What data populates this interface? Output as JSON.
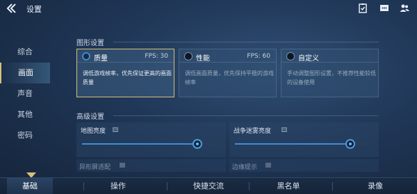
{
  "header": {
    "title": "设置"
  },
  "sidebar": {
    "items": [
      {
        "label": "综合"
      },
      {
        "label": "画面"
      },
      {
        "label": "声音"
      },
      {
        "label": "其他"
      },
      {
        "label": "密码"
      }
    ],
    "active_index": 1
  },
  "graphics": {
    "section_title": "图形设置",
    "options": [
      {
        "name": "质量",
        "fps": "FPS: 30",
        "desc": "调低游戏帧率，优先保证更高的画面质量",
        "selected": true
      },
      {
        "name": "性能",
        "fps": "FPS: 60",
        "desc": "调低画面质量，优先保持平稳的游戏帧率",
        "selected": false
      },
      {
        "name": "自定义",
        "fps": "",
        "desc": "手动调整图形设置，不推荐性能较低的设备使用",
        "selected": false
      }
    ]
  },
  "advanced": {
    "section_title": "高级设置",
    "map_brightness": {
      "label": "地图亮度",
      "value": 0.84
    },
    "fog_brightness": {
      "label": "战争迷雾亮度",
      "value": 0.84
    },
    "aspect_adapt": {
      "label": "异形屏适配"
    },
    "edge_hint": {
      "label": "边缘提示"
    }
  },
  "bottom_tabs": [
    {
      "label": "基础"
    },
    {
      "label": "操作"
    },
    {
      "label": "快捷交流"
    },
    {
      "label": "黑名单"
    },
    {
      "label": "录像"
    }
  ],
  "colors": {
    "accent_gold": "#d6c07a",
    "accent_blue": "#3d8fd6"
  }
}
